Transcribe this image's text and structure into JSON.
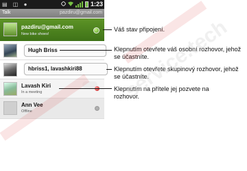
{
  "status_bar": {
    "left_icons": "▤ ◫ ●",
    "time": "1:23",
    "icons": [
      "sync-icon",
      "wifi-icon",
      "signal-icon",
      "battery-icon"
    ]
  },
  "title_bar": {
    "app": "Talk",
    "account": "pazdiru@gmail.com"
  },
  "me": {
    "name": "pazdiru@gmail.com",
    "status": "New bike shoes!"
  },
  "contacts": [
    {
      "name": "Hugh Briss",
      "status": ""
    },
    {
      "name": "hbriss1, lavashkiri88",
      "status": ""
    },
    {
      "name": "Lavash Kiri",
      "status": "In a meeting"
    },
    {
      "name": "Ann Vee",
      "status": "Offline"
    }
  ],
  "annotations": [
    "Váš stav připojení.",
    "Klepnutím otevřete váš osobní rozhovor, jehož se účastníte.",
    "Klepnutím otevřete skupinový rozhovor, jehož se účastníte.",
    "Klepnutím na přítele jej pozvete na rozhovor."
  ],
  "watermark": "service.tech",
  "colors": {
    "online": "#4f9b13",
    "busy": "#c01818",
    "offline": "#b0b0b0",
    "me_bar": "#4f8a20"
  }
}
